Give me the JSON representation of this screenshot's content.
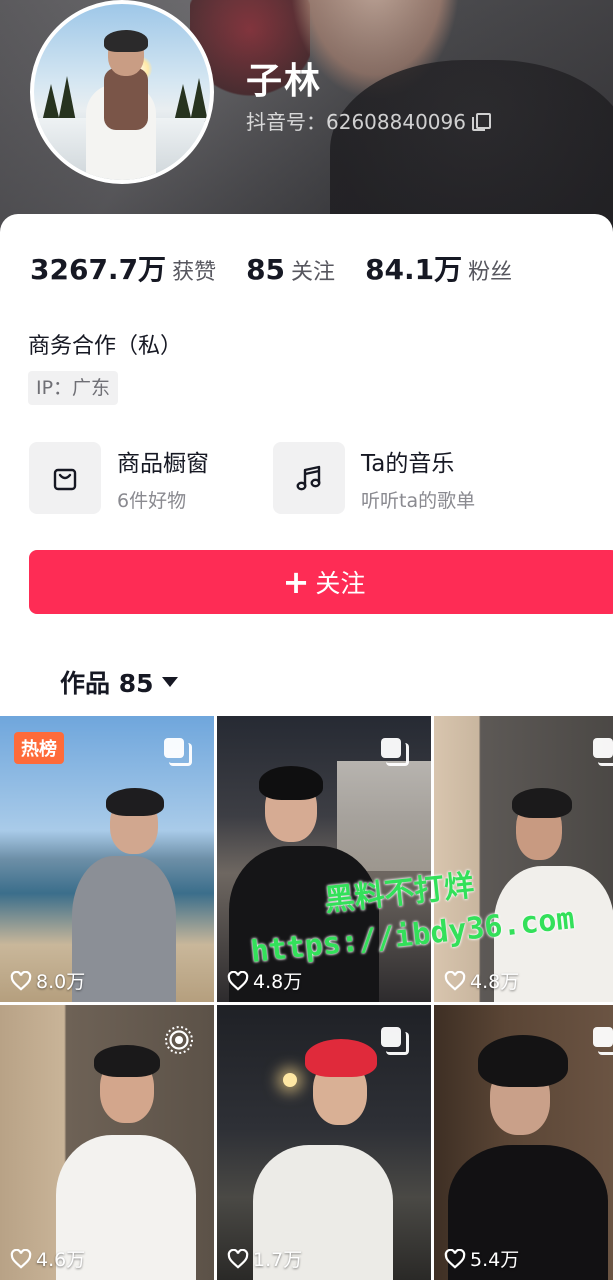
{
  "profile": {
    "username": "子林",
    "douyin_id": "抖音号：62608840096"
  },
  "stats": [
    {
      "value": "3267.7万",
      "label": "获赞"
    },
    {
      "value": "85",
      "label": "关注"
    },
    {
      "value": "84.1万",
      "label": "粉丝"
    }
  ],
  "bio": "商务合作（私）",
  "ip_tag": "IP：广东",
  "features": [
    {
      "title": "商品橱窗",
      "subtitle": "6件好物",
      "icon": "shopping-bag-icon"
    },
    {
      "title": "Ta的音乐",
      "subtitle": "听听ta的歌单",
      "icon": "music-note-icon"
    }
  ],
  "follow_button": {
    "label": "关注",
    "icon": "plus"
  },
  "works_tab": {
    "label": "作品 85"
  },
  "videos": [
    {
      "likes": "8.0万",
      "badge": "热榜",
      "corner_icon": "multi-image-icon"
    },
    {
      "likes": "4.8万",
      "corner_icon": "multi-image-icon"
    },
    {
      "likes": "4.8万",
      "corner_icon": "multi-image-icon"
    },
    {
      "likes": "4.6万",
      "corner_icon": "live-photo-icon"
    },
    {
      "likes": "1.7万",
      "corner_icon": "multi-image-icon"
    },
    {
      "likes": "5.4万",
      "corner_icon": "multi-image-icon"
    }
  ],
  "watermark": {
    "line1": "黑料不打烊",
    "line2": "https://ibdy36.com"
  },
  "colors": {
    "accent": "#fe2c55",
    "hot_badge": "#fe6b3a",
    "watermark": "#33e05a"
  }
}
